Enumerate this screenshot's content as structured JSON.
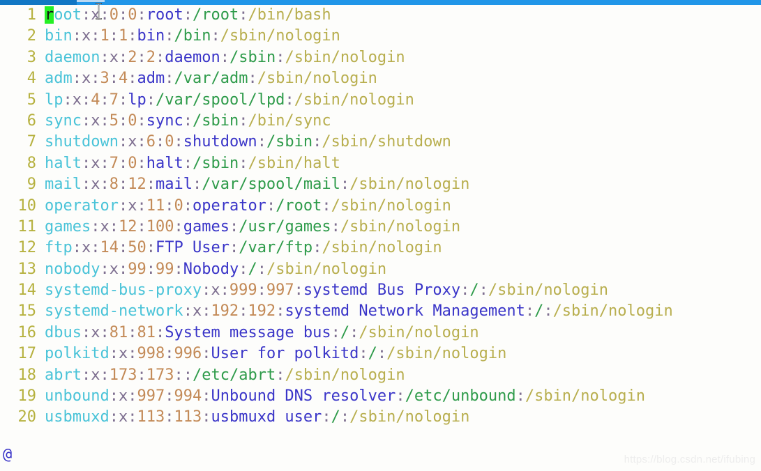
{
  "window": {
    "titlebar_color": "#2196e8",
    "tab_color": "#1277c4"
  },
  "editor": {
    "background_color": "#fdfdfb",
    "filler_char": "@",
    "cursor": {
      "line": 1,
      "column": 1,
      "char": "r",
      "background_color": "#24f024"
    },
    "colors": {
      "line_number": "#b6b13f",
      "username": "#49c3d8",
      "separator": "#7e6f90",
      "password_field": "#7e6f90",
      "uid_gid": "#c38a57",
      "gecos": "#3a35c8",
      "home_dir": "#2e9b4a",
      "shell": "#b8ae4e"
    },
    "lines": [
      {
        "n": "1",
        "user": "root",
        "pw": "x",
        "uid": "0",
        "gid": "0",
        "gecos": "root",
        "home": "/root",
        "shell": "/bin/bash"
      },
      {
        "n": "2",
        "user": "bin",
        "pw": "x",
        "uid": "1",
        "gid": "1",
        "gecos": "bin",
        "home": "/bin",
        "shell": "/sbin/nologin"
      },
      {
        "n": "3",
        "user": "daemon",
        "pw": "x",
        "uid": "2",
        "gid": "2",
        "gecos": "daemon",
        "home": "/sbin",
        "shell": "/sbin/nologin"
      },
      {
        "n": "4",
        "user": "adm",
        "pw": "x",
        "uid": "3",
        "gid": "4",
        "gecos": "adm",
        "home": "/var/adm",
        "shell": "/sbin/nologin"
      },
      {
        "n": "5",
        "user": "lp",
        "pw": "x",
        "uid": "4",
        "gid": "7",
        "gecos": "lp",
        "home": "/var/spool/lpd",
        "shell": "/sbin/nologin"
      },
      {
        "n": "6",
        "user": "sync",
        "pw": "x",
        "uid": "5",
        "gid": "0",
        "gecos": "sync",
        "home": "/sbin",
        "shell": "/bin/sync"
      },
      {
        "n": "7",
        "user": "shutdown",
        "pw": "x",
        "uid": "6",
        "gid": "0",
        "gecos": "shutdown",
        "home": "/sbin",
        "shell": "/sbin/shutdown"
      },
      {
        "n": "8",
        "user": "halt",
        "pw": "x",
        "uid": "7",
        "gid": "0",
        "gecos": "halt",
        "home": "/sbin",
        "shell": "/sbin/halt"
      },
      {
        "n": "9",
        "user": "mail",
        "pw": "x",
        "uid": "8",
        "gid": "12",
        "gecos": "mail",
        "home": "/var/spool/mail",
        "shell": "/sbin/nologin"
      },
      {
        "n": "10",
        "user": "operator",
        "pw": "x",
        "uid": "11",
        "gid": "0",
        "gecos": "operator",
        "home": "/root",
        "shell": "/sbin/nologin"
      },
      {
        "n": "11",
        "user": "games",
        "pw": "x",
        "uid": "12",
        "gid": "100",
        "gecos": "games",
        "home": "/usr/games",
        "shell": "/sbin/nologin"
      },
      {
        "n": "12",
        "user": "ftp",
        "pw": "x",
        "uid": "14",
        "gid": "50",
        "gecos": "FTP User",
        "home": "/var/ftp",
        "shell": "/sbin/nologin"
      },
      {
        "n": "13",
        "user": "nobody",
        "pw": "x",
        "uid": "99",
        "gid": "99",
        "gecos": "Nobody",
        "home": "/",
        "shell": "/sbin/nologin"
      },
      {
        "n": "14",
        "user": "systemd-bus-proxy",
        "pw": "x",
        "uid": "999",
        "gid": "997",
        "gecos": "systemd Bus Proxy",
        "home": "/",
        "shell": "/sbin/nologin"
      },
      {
        "n": "15",
        "user": "systemd-network",
        "pw": "x",
        "uid": "192",
        "gid": "192",
        "gecos": "systemd Network Management",
        "home": "/",
        "shell": "/sbin/nologin"
      },
      {
        "n": "16",
        "user": "dbus",
        "pw": "x",
        "uid": "81",
        "gid": "81",
        "gecos": "System message bus",
        "home": "/",
        "shell": "/sbin/nologin"
      },
      {
        "n": "17",
        "user": "polkitd",
        "pw": "x",
        "uid": "998",
        "gid": "996",
        "gecos": "User for polkitd",
        "home": "/",
        "shell": "/sbin/nologin"
      },
      {
        "n": "18",
        "user": "abrt",
        "pw": "x",
        "uid": "173",
        "gid": "173",
        "gecos": "",
        "home": "/etc/abrt",
        "shell": "/sbin/nologin"
      },
      {
        "n": "19",
        "user": "unbound",
        "pw": "x",
        "uid": "997",
        "gid": "994",
        "gecos": "Unbound DNS resolver",
        "home": "/etc/unbound",
        "shell": "/sbin/nologin"
      },
      {
        "n": "20",
        "user": "usbmuxd",
        "pw": "x",
        "uid": "113",
        "gid": "113",
        "gecos": "usbmuxd user",
        "home": "/",
        "shell": "/sbin/nologin"
      }
    ]
  },
  "watermark": {
    "text": "https://blog.csdn.net/ifubing"
  }
}
